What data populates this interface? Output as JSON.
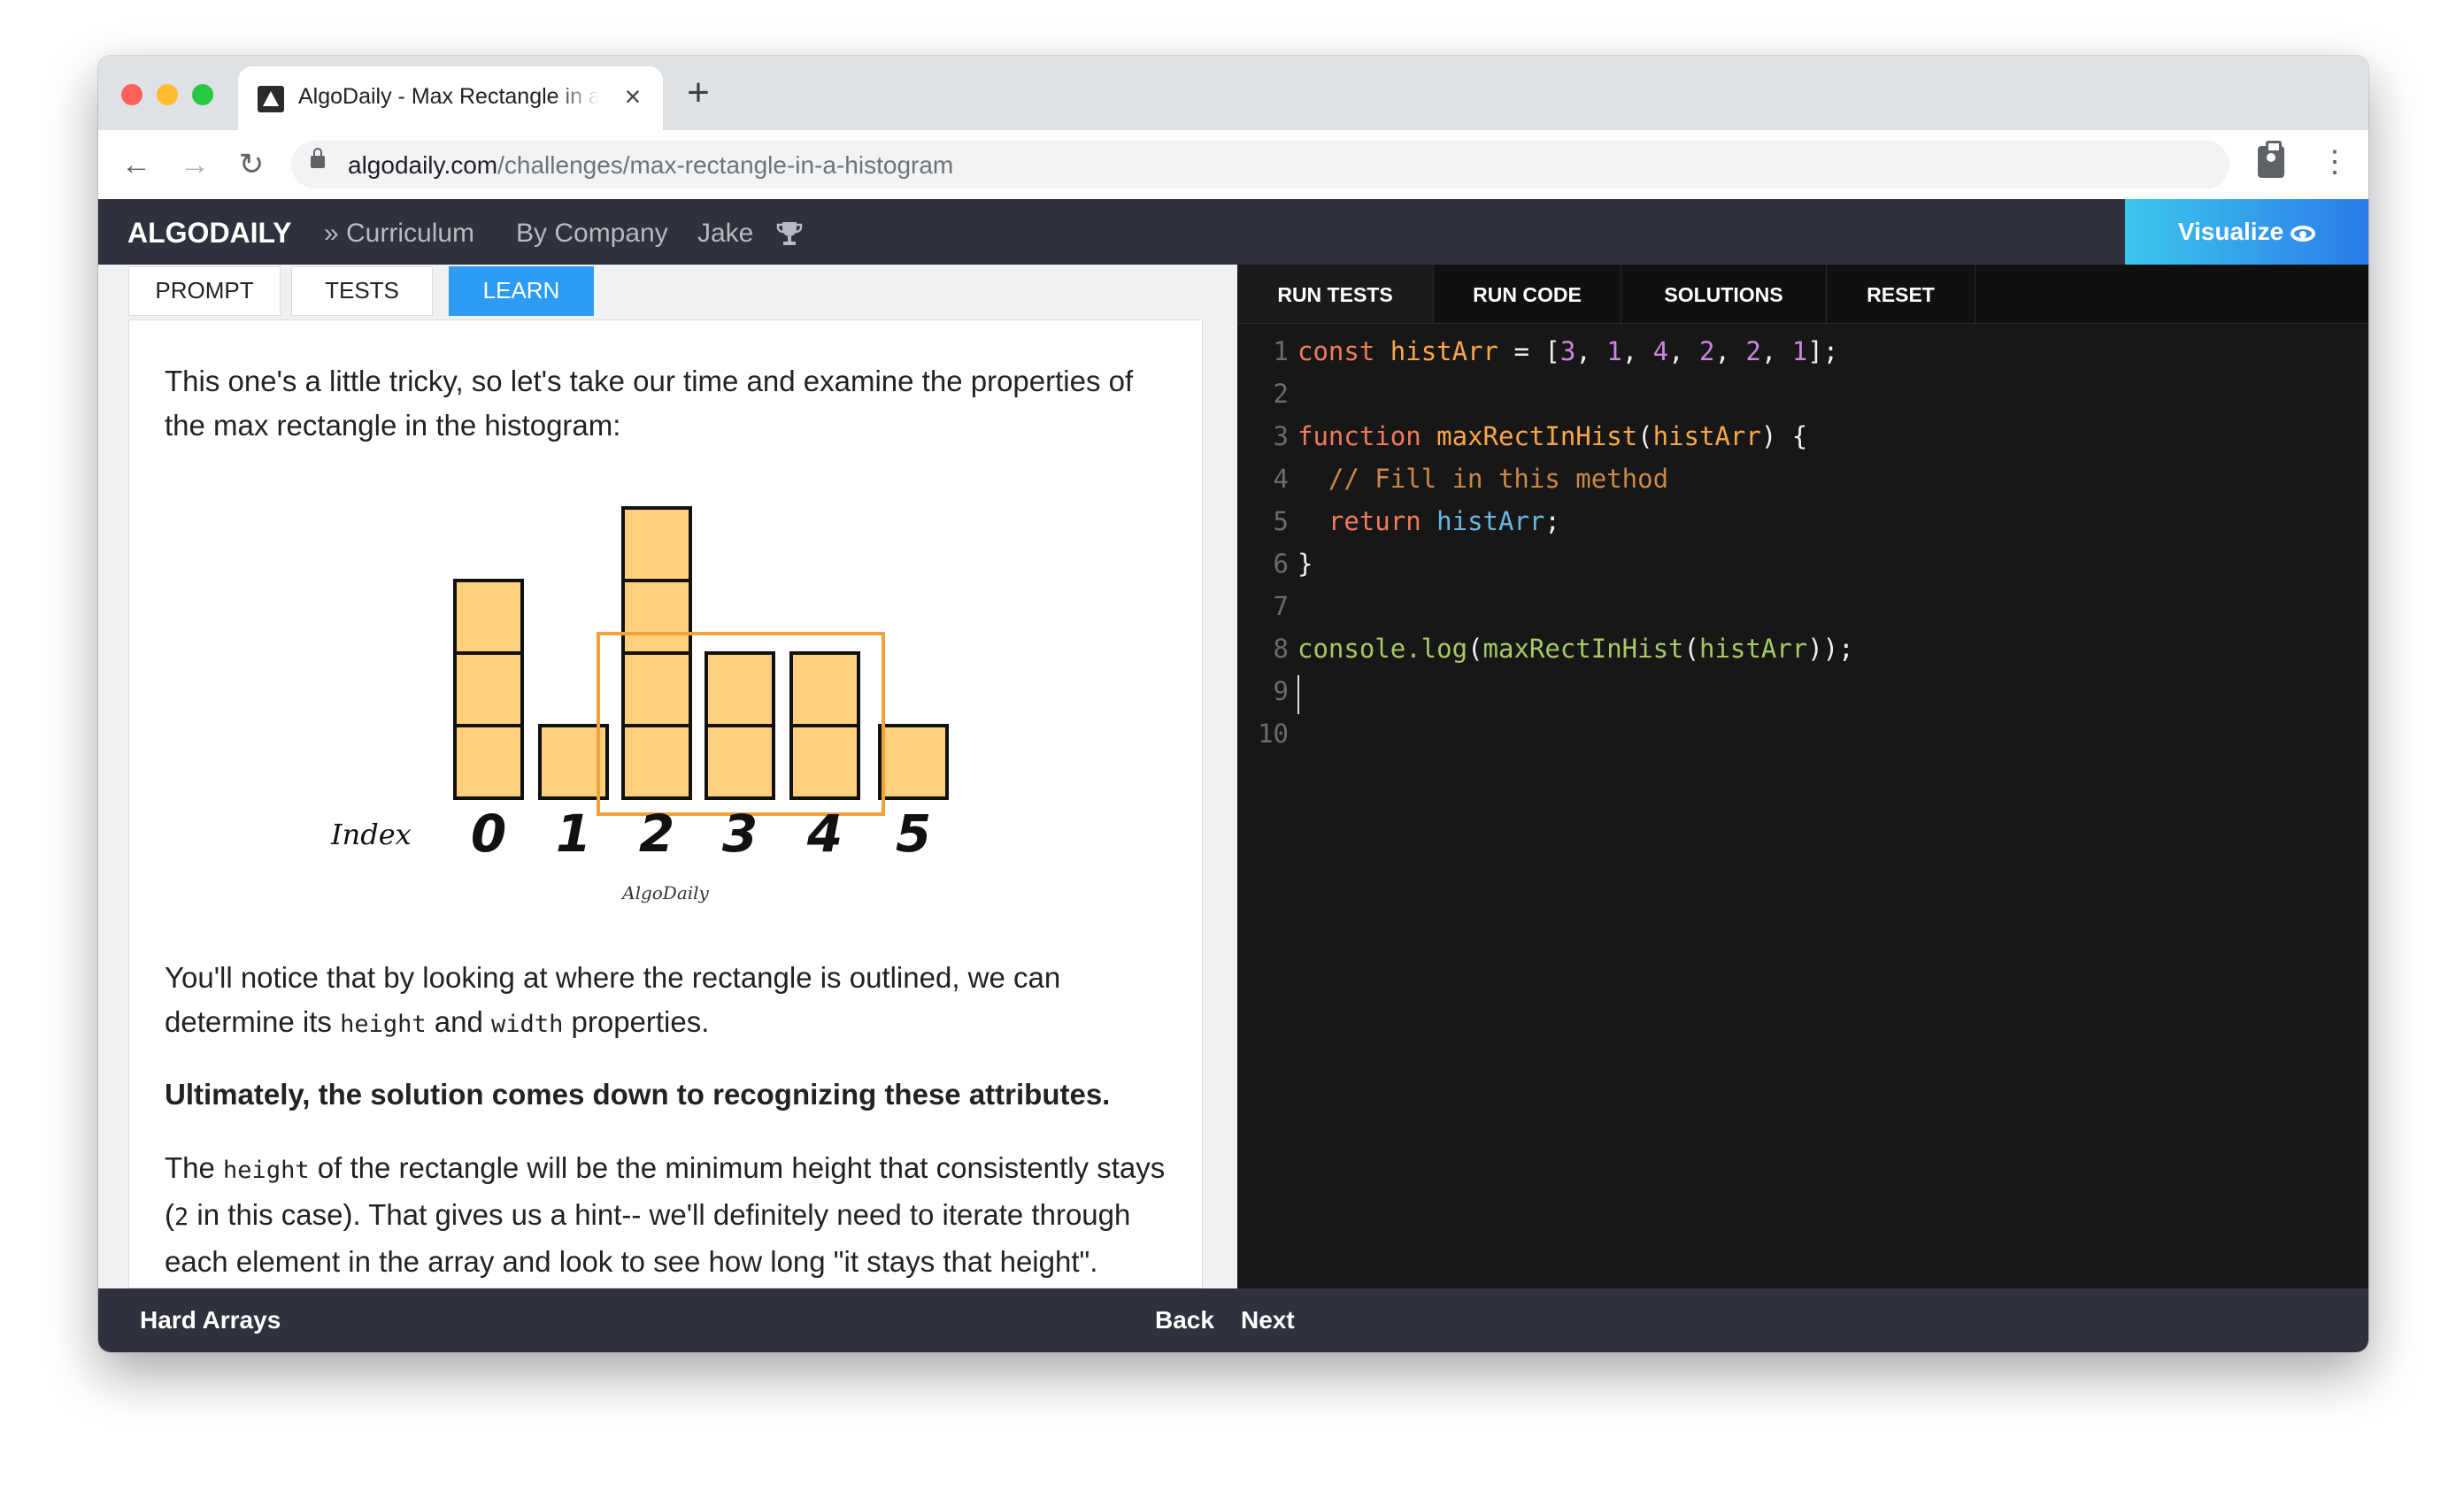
{
  "browser": {
    "tab_title": "AlgoDaily - Max Rectangle in a Histogram",
    "url_domain": "algodaily.com",
    "url_path": "/challenges/max-rectangle-in-a-histogram",
    "icons": [
      "back-arrow-icon",
      "forward-arrow-icon",
      "reload-icon",
      "lock-icon",
      "extension-icon",
      "menu-icon"
    ]
  },
  "header": {
    "logo": "ALGODAILY",
    "nav": [
      "» Curriculum",
      "By Company",
      "Jake"
    ],
    "visualize_label": "Visualize"
  },
  "left_tabs": [
    {
      "label": "PROMPT",
      "active": false
    },
    {
      "label": "TESTS",
      "active": false
    },
    {
      "label": "LEARN",
      "active": true
    }
  ],
  "content": {
    "intro": "This one's a little tricky, so let's take our time and examine the properties of the max rectangle in the histogram:",
    "diagram": {
      "index_label": "Index",
      "indices": [
        "0",
        "1",
        "2",
        "3",
        "4",
        "5"
      ],
      "heights": [
        3,
        1,
        4,
        2,
        2,
        1
      ],
      "highlight_range": [
        2,
        4
      ],
      "watermark": "AlgoDaily",
      "bar_color": "#fecf7d",
      "outline_color": "#f2a23a"
    },
    "p2_a": "You'll notice that by looking at where the rectangle is outlined, we can determine its ",
    "p2_code1": "height",
    "p2_b": " and ",
    "p2_code2": "width",
    "p2_c": " properties.",
    "p3": "Ultimately, the solution comes down to recognizing these attributes.",
    "p4_a": "The ",
    "p4_code1": "height",
    "p4_b": " of the rectangle will be the minimum height that consistently stays (",
    "p4_code2": "2",
    "p4_c": " in this case). That gives us a hint-- we'll definitely need to iterate through each element in the array and look to see how long \"it stays that height\"."
  },
  "editor_tabs": [
    "RUN TESTS",
    "RUN CODE",
    "SOLUTIONS",
    "RESET"
  ],
  "editor_lines": [
    "1",
    "2",
    "3",
    "4",
    "5",
    "6",
    "7",
    "8",
    "9",
    "10"
  ],
  "footer": {
    "category": "Hard Arrays",
    "back": "Back",
    "next": "Next"
  }
}
